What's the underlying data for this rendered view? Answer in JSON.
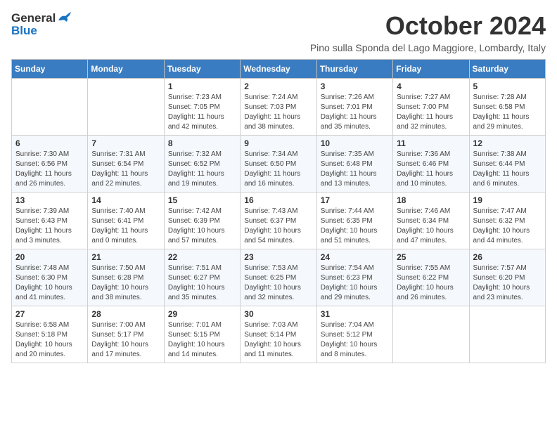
{
  "header": {
    "logo_general": "General",
    "logo_blue": "Blue",
    "title": "October 2024",
    "subtitle": "Pino sulla Sponda del Lago Maggiore, Lombardy, Italy"
  },
  "days_of_week": [
    "Sunday",
    "Monday",
    "Tuesday",
    "Wednesday",
    "Thursday",
    "Friday",
    "Saturday"
  ],
  "weeks": [
    [
      {
        "day": "",
        "info": ""
      },
      {
        "day": "",
        "info": ""
      },
      {
        "day": "1",
        "info": "Sunrise: 7:23 AM\nSunset: 7:05 PM\nDaylight: 11 hours and 42 minutes."
      },
      {
        "day": "2",
        "info": "Sunrise: 7:24 AM\nSunset: 7:03 PM\nDaylight: 11 hours and 38 minutes."
      },
      {
        "day": "3",
        "info": "Sunrise: 7:26 AM\nSunset: 7:01 PM\nDaylight: 11 hours and 35 minutes."
      },
      {
        "day": "4",
        "info": "Sunrise: 7:27 AM\nSunset: 7:00 PM\nDaylight: 11 hours and 32 minutes."
      },
      {
        "day": "5",
        "info": "Sunrise: 7:28 AM\nSunset: 6:58 PM\nDaylight: 11 hours and 29 minutes."
      }
    ],
    [
      {
        "day": "6",
        "info": "Sunrise: 7:30 AM\nSunset: 6:56 PM\nDaylight: 11 hours and 26 minutes."
      },
      {
        "day": "7",
        "info": "Sunrise: 7:31 AM\nSunset: 6:54 PM\nDaylight: 11 hours and 22 minutes."
      },
      {
        "day": "8",
        "info": "Sunrise: 7:32 AM\nSunset: 6:52 PM\nDaylight: 11 hours and 19 minutes."
      },
      {
        "day": "9",
        "info": "Sunrise: 7:34 AM\nSunset: 6:50 PM\nDaylight: 11 hours and 16 minutes."
      },
      {
        "day": "10",
        "info": "Sunrise: 7:35 AM\nSunset: 6:48 PM\nDaylight: 11 hours and 13 minutes."
      },
      {
        "day": "11",
        "info": "Sunrise: 7:36 AM\nSunset: 6:46 PM\nDaylight: 11 hours and 10 minutes."
      },
      {
        "day": "12",
        "info": "Sunrise: 7:38 AM\nSunset: 6:44 PM\nDaylight: 11 hours and 6 minutes."
      }
    ],
    [
      {
        "day": "13",
        "info": "Sunrise: 7:39 AM\nSunset: 6:43 PM\nDaylight: 11 hours and 3 minutes."
      },
      {
        "day": "14",
        "info": "Sunrise: 7:40 AM\nSunset: 6:41 PM\nDaylight: 11 hours and 0 minutes."
      },
      {
        "day": "15",
        "info": "Sunrise: 7:42 AM\nSunset: 6:39 PM\nDaylight: 10 hours and 57 minutes."
      },
      {
        "day": "16",
        "info": "Sunrise: 7:43 AM\nSunset: 6:37 PM\nDaylight: 10 hours and 54 minutes."
      },
      {
        "day": "17",
        "info": "Sunrise: 7:44 AM\nSunset: 6:35 PM\nDaylight: 10 hours and 51 minutes."
      },
      {
        "day": "18",
        "info": "Sunrise: 7:46 AM\nSunset: 6:34 PM\nDaylight: 10 hours and 47 minutes."
      },
      {
        "day": "19",
        "info": "Sunrise: 7:47 AM\nSunset: 6:32 PM\nDaylight: 10 hours and 44 minutes."
      }
    ],
    [
      {
        "day": "20",
        "info": "Sunrise: 7:48 AM\nSunset: 6:30 PM\nDaylight: 10 hours and 41 minutes."
      },
      {
        "day": "21",
        "info": "Sunrise: 7:50 AM\nSunset: 6:28 PM\nDaylight: 10 hours and 38 minutes."
      },
      {
        "day": "22",
        "info": "Sunrise: 7:51 AM\nSunset: 6:27 PM\nDaylight: 10 hours and 35 minutes."
      },
      {
        "day": "23",
        "info": "Sunrise: 7:53 AM\nSunset: 6:25 PM\nDaylight: 10 hours and 32 minutes."
      },
      {
        "day": "24",
        "info": "Sunrise: 7:54 AM\nSunset: 6:23 PM\nDaylight: 10 hours and 29 minutes."
      },
      {
        "day": "25",
        "info": "Sunrise: 7:55 AM\nSunset: 6:22 PM\nDaylight: 10 hours and 26 minutes."
      },
      {
        "day": "26",
        "info": "Sunrise: 7:57 AM\nSunset: 6:20 PM\nDaylight: 10 hours and 23 minutes."
      }
    ],
    [
      {
        "day": "27",
        "info": "Sunrise: 6:58 AM\nSunset: 5:18 PM\nDaylight: 10 hours and 20 minutes."
      },
      {
        "day": "28",
        "info": "Sunrise: 7:00 AM\nSunset: 5:17 PM\nDaylight: 10 hours and 17 minutes."
      },
      {
        "day": "29",
        "info": "Sunrise: 7:01 AM\nSunset: 5:15 PM\nDaylight: 10 hours and 14 minutes."
      },
      {
        "day": "30",
        "info": "Sunrise: 7:03 AM\nSunset: 5:14 PM\nDaylight: 10 hours and 11 minutes."
      },
      {
        "day": "31",
        "info": "Sunrise: 7:04 AM\nSunset: 5:12 PM\nDaylight: 10 hours and 8 minutes."
      },
      {
        "day": "",
        "info": ""
      },
      {
        "day": "",
        "info": ""
      }
    ]
  ]
}
